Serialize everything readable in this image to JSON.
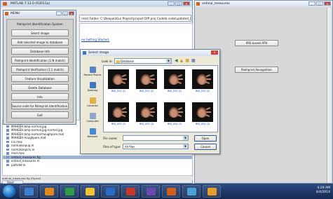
{
  "matlab": {
    "title": "MATLAB 7.12.0 (R2011a)",
    "current_folder": "rrent Folder: C:\\Deepali\\Gui Project\\project DIP proj Code\\b code\\updated_iris_code_let",
    "getting_started": "ee Getting Started."
  },
  "menu": {
    "title": "MENU",
    "header": "Palmprint Identification System",
    "buttons": [
      "Select image",
      "Add selected image to database",
      "Database Info",
      "Palmprint Identification (1:N match)",
      "Palmprint Verification (1:1 match)",
      "Feature Visualization",
      "Delete Database",
      "Info",
      "Source code for Palmprint Identification System",
      "Exit"
    ]
  },
  "figure": {
    "title": "ordinal_measures",
    "btn_iris": "IRIS based ATN",
    "btn_palm": "Palmprint Recognition"
  },
  "dialog": {
    "title": "Select image",
    "look_in_label": "Look in:",
    "look_in_value": "Database",
    "places": [
      "Recent Places",
      "Desktop",
      "Libraries",
      "Computer",
      "Network"
    ],
    "files": [
      "IMG_001 (1)",
      "IMG_001 (2)",
      "IMG_002 (1)",
      "IMG_002 (2)",
      "IMG_003 (1)",
      "IMG_003 (2)",
      "IMG_004 (1)",
      "IMG_004 (2)"
    ],
    "file_name_label": "File name:",
    "file_name_value": "",
    "files_of_type_label": "Files of type:",
    "files_of_type_value": "All files",
    "open_label": "Open",
    "cancel_label": "Cancel"
  },
  "filelist": {
    "items": [
      "maheeb.bmp",
      "MAHEEH.bmp-normal.jpg",
      "MAHEEH.bmp-normal.jpg-normal.jpg",
      "MAHEEH.bmp-normal-houghpore.mat",
      "MAHEEH-houghpore.mat",
      "iris.mex",
      "normalisepup.m",
      "normalizepiris.m",
      "mnd.mex",
      "ordinal_measures.fig",
      "ordinal_measures.m",
      "pathdef.m"
    ],
    "selected_index": 9,
    "path_text": "ordinal_measures.fig (Figure)",
    "start": "Start"
  },
  "taskbar": {
    "time": "4:29 AM",
    "date": "4/4/2014",
    "app_colors": [
      "#3a7fd0",
      "#e08a1e",
      "#2f9c4a",
      "#f2c230",
      "#2a6ac6",
      "#c7352b",
      "#6a4ab0",
      "#d0601c",
      "#4aa3d8",
      "#e2a02b"
    ]
  }
}
